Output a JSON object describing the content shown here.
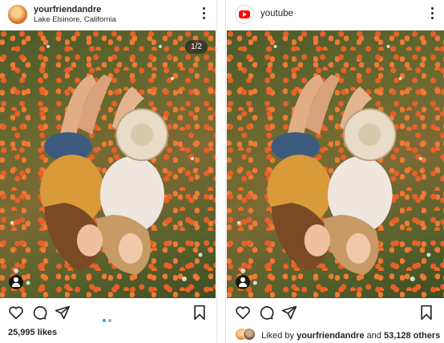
{
  "left_post": {
    "username": "yourfriendandre",
    "location": "Lake Elsinore, California",
    "photo_counter": "1/2",
    "likes": "25,995 likes",
    "carousel_dots": 2,
    "active_dot": 0
  },
  "right_post": {
    "username": "youtube",
    "liked_by_prefix": "Liked by",
    "liked_by_user": "yourfriendandre",
    "liked_by_and": "and",
    "liked_by_others": "53,128 others"
  },
  "icons": {
    "more": "more-options-icon",
    "like": "heart-icon",
    "comment": "comment-icon",
    "share": "send-icon",
    "save": "bookmark-icon",
    "tag": "user-tag-icon",
    "brand": "youtube-logo"
  },
  "colors": {
    "text": "#262626",
    "dot_active": "#3897f0",
    "dot_inactive": "#a8a8a8",
    "youtube_red": "#ff0000"
  }
}
